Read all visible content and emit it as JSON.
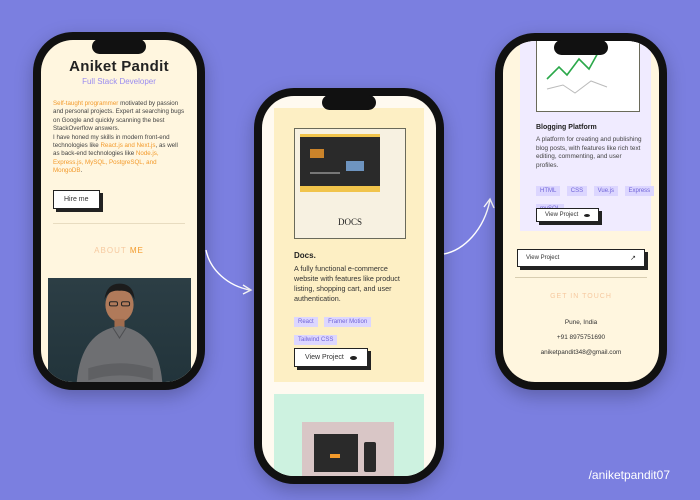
{
  "colors": {
    "background": "#7b7fe0",
    "accent": "#f39a2b",
    "subtitle": "#9a8cf0",
    "tag_bg": "#dcd6ff"
  },
  "phone1": {
    "name": "Aniket Pandit",
    "role": "Full Stack Developer",
    "bio_lead": "Self-taught programmer",
    "bio_1": " motivated by passion and personal projects. Expert at searching bugs on Google and quickly scanning the best StackOverflow answers.",
    "bio_2": "I have honed my skills in modern front-end technologies like ",
    "bio_fe": "React.js and Next.js",
    "bio_3": ", as well as back-end technologies like ",
    "bio_be": "Node.js, Express.js, MySQL, PostgreSQL, and MongoDB",
    "bio_end": ".",
    "hire_button": "Hire me",
    "about_heading_a": "ABOUT",
    "about_heading_b": " ME"
  },
  "phone2": {
    "project_logo_text": "DOCS",
    "project_title": "Docs.",
    "project_description": "A fully functional e-commerce website with features like product listing, shopping cart, and user authentication.",
    "tags": [
      "React",
      "Framer Motion",
      "Tailwind CSS"
    ],
    "view_button": "View Project",
    "view_icon": "eye-icon"
  },
  "phone3": {
    "project_title": "Blogging Platform",
    "project_description": "A platform for creating and publishing blog posts, with features like rich text editing, commenting, and user profiles.",
    "tags": [
      "HTML",
      "CSS",
      "Vue.js",
      "Express",
      "mySQL"
    ],
    "view_button": "View Project",
    "view_icon": "eye-icon",
    "view_button_2": "View Project",
    "view_icon_2": "arrow-up-right-icon",
    "contact_heading": "GET IN TOUCH",
    "location": "Pune, India",
    "phone": "+91 8975751690",
    "email": "aniketpandit348@gmail.com"
  },
  "handle": "/aniketpandit07"
}
